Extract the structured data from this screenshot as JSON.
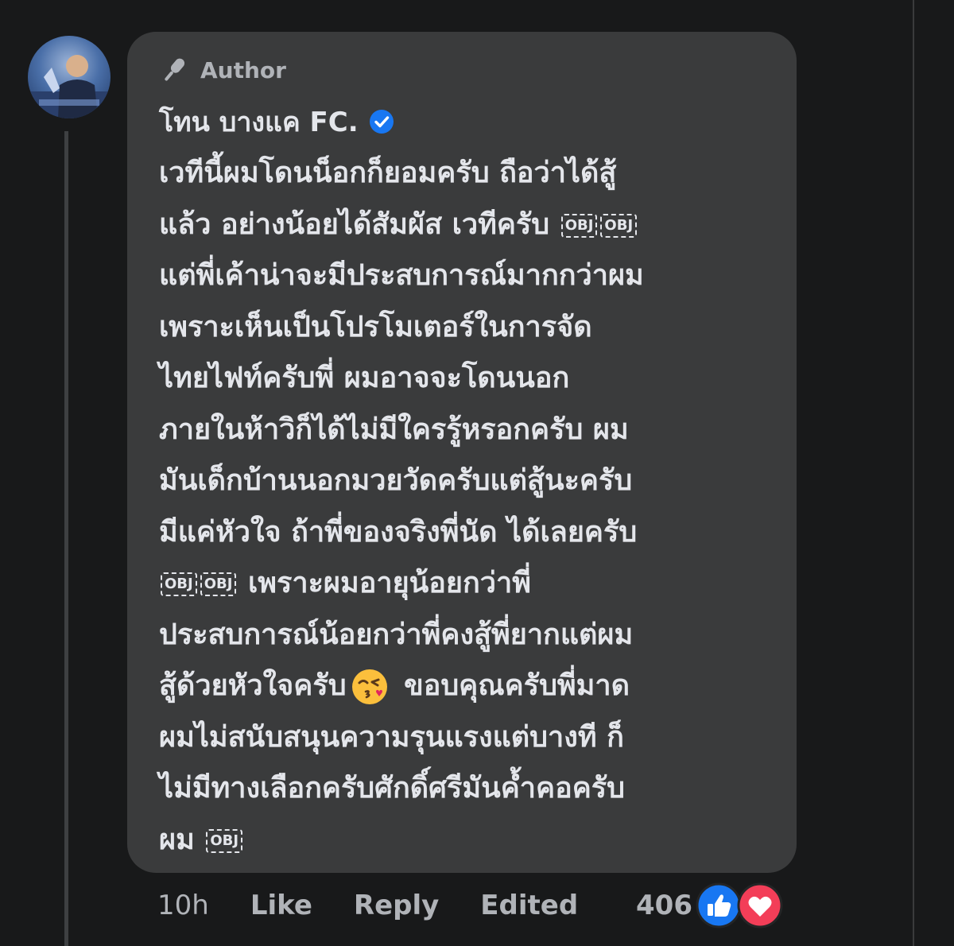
{
  "comment": {
    "badge": "Author",
    "author_name": "โทน บางแค FC.",
    "lines": [
      {
        "text": "เวทีนี้ผมโดนน็อกก็ยอมครับ ถือว่าได้สู้"
      },
      {
        "text": "แล้ว อย่างน้อยได้สัมผัส เวทีครับ"
      },
      {
        "text": "แต่พี่เค้าน่าจะมีประสบการณ์มากกว่าผม"
      },
      {
        "text": "เพราะเห็นเป็นโปรโมเตอร์ในการจัด"
      },
      {
        "text": "ไทยไฟท์ครับพี่ ผมอาจจะโดนนอก"
      },
      {
        "text": "ภายในห้าวิก็ได้ไม่มีใครรู้หรอกครับ ผม"
      },
      {
        "text": "มันเด็กบ้านนอกมวยวัดครับแต่สู้นะครับ"
      },
      {
        "text": "มีแค่หัวใจ ถ้าพี่ของจริงพี่นัด ได้เลยครับ"
      },
      {
        "text": "เพราะผมอายุน้อยกว่าพี่"
      },
      {
        "text": "ประสบการณ์น้อยกว่าพี่คงสู้พี่ยากแต่ผม"
      },
      {
        "text": "สู้ด้วยหัวใจครับ"
      },
      {
        "text": "ผมไม่สนับสนุนความรุนแรงแต่บางที ก็"
      },
      {
        "text": "ไม่มีทางเลือกครับศักดิ์ศรีมันค้ำคอครับ"
      },
      {
        "text": "ผม"
      }
    ],
    "line11_after_emoji": "ขอบคุณครับพี่มาด",
    "obj_glyph": "OBJ",
    "emoji_name": "face-blowing-a-kiss"
  },
  "actions": {
    "time": "10h",
    "like": "Like",
    "reply": "Reply",
    "edited": "Edited"
  },
  "reactions": {
    "count": "406",
    "icons": [
      "like-icon",
      "love-icon"
    ],
    "like_color": "#1877f2",
    "love_color": "#f33e58"
  },
  "colors": {
    "background": "#18191a",
    "bubble": "#3a3b3c",
    "primary_text": "#e4e6eb",
    "secondary_text": "#b0b3b8",
    "verified": "#1877f2"
  }
}
